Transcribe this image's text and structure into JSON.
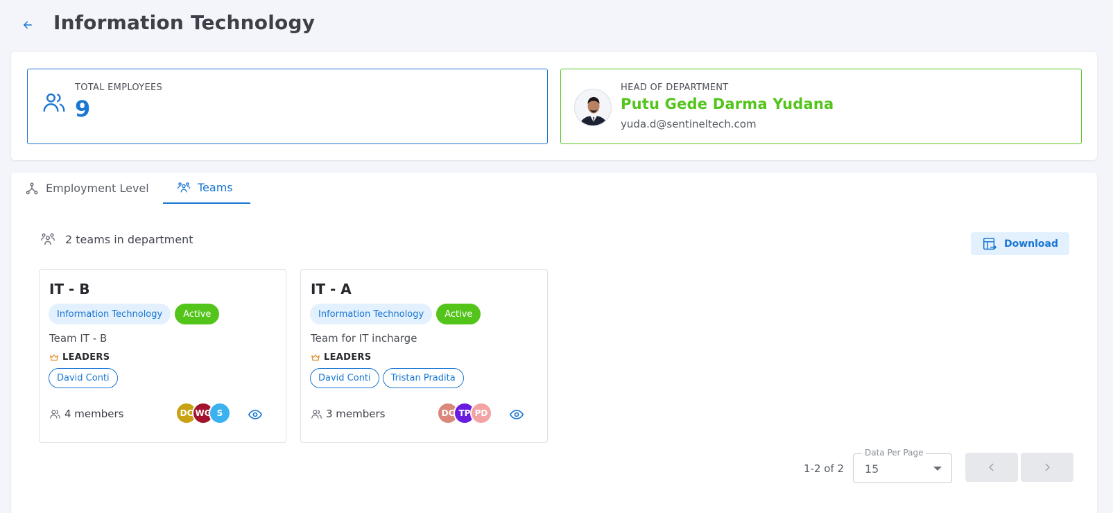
{
  "header": {
    "title": "Information Technology"
  },
  "summary": {
    "employees_label": "TOTAL EMPLOYEES",
    "employees_count": "9",
    "head_label": "HEAD OF DEPARTMENT",
    "head_name": "Putu Gede Darma Yudana",
    "head_email": "yuda.d@sentineltech.com"
  },
  "tabs": [
    {
      "label": "Employment Level",
      "icon": "hierarchy-icon",
      "active": false
    },
    {
      "label": "Teams",
      "icon": "team-icon",
      "active": true
    }
  ],
  "teams_section": {
    "count_text": "2 teams in department",
    "download_label": "Download"
  },
  "teams": [
    {
      "name": "IT - B",
      "department": "Information Technology",
      "status": "Active",
      "description": "Team IT - B",
      "leaders_label": "LEADERS",
      "leaders": [
        "David Conti"
      ],
      "members_text": "4 members",
      "avatars": [
        {
          "initials": "DC",
          "color": "#c9a214"
        },
        {
          "initials": "WG",
          "color": "#a3132e"
        },
        {
          "initials": "S",
          "color": "#3bb1ef"
        }
      ]
    },
    {
      "name": "IT - A",
      "department": "Information Technology",
      "status": "Active",
      "description": "Team for IT incharge",
      "leaders_label": "LEADERS",
      "leaders": [
        "David Conti",
        "Tristan Pradita"
      ],
      "members_text": "3 members",
      "avatars": [
        {
          "initials": "DC",
          "color": "#d9887a"
        },
        {
          "initials": "TP",
          "color": "#6a1be0"
        },
        {
          "initials": "PD",
          "color": "#f3a3a3"
        }
      ]
    }
  ],
  "pagination": {
    "info": "1-2 of 2",
    "per_page_label": "Data Per Page",
    "per_page_value": "15"
  },
  "colors": {
    "primary": "#1976d2",
    "success": "#52c41a",
    "chip_bg": "#e3f0fd"
  }
}
